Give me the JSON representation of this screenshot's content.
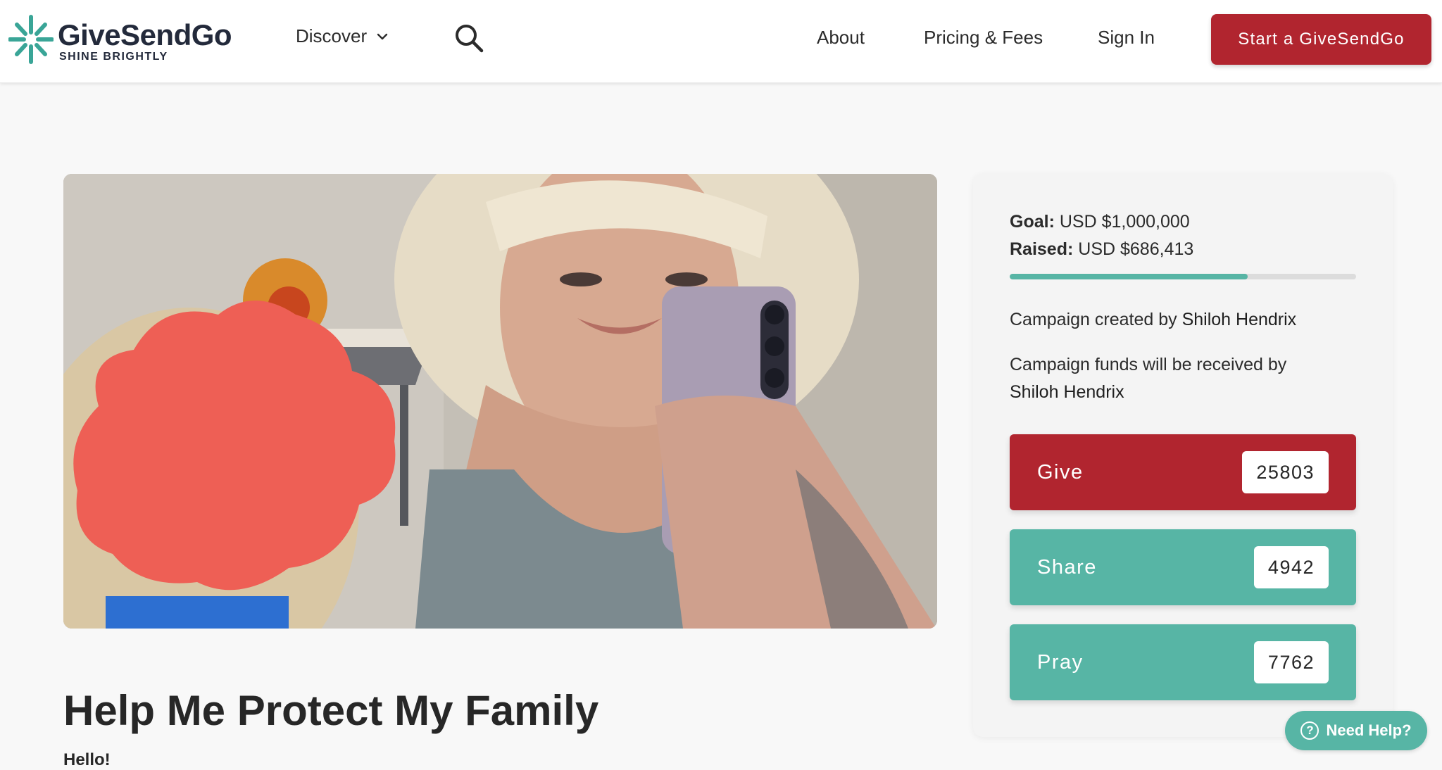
{
  "header": {
    "logo_name": "GiveSendGo",
    "logo_tagline": "SHINE BRIGHTLY",
    "discover_label": "Discover",
    "about_label": "About",
    "pricing_label": "Pricing & Fees",
    "signin_label": "Sign In",
    "cta_label": "Start a GiveSendGo"
  },
  "campaign": {
    "title": "Help Me Protect My Family",
    "greeting": "Hello!",
    "goal_label": "Goal:",
    "goal_value": "USD $1,000,000",
    "raised_label": "Raised:",
    "raised_value": "USD $686,413",
    "progress_fraction": 0.686,
    "created_by_text": "Campaign created by",
    "creator_name": "Shiloh Hendrix",
    "funds_text": "Campaign funds will be received by",
    "recipient_name": "Shiloh Hendrix"
  },
  "actions": {
    "give_label": "Give",
    "give_count": "25803",
    "share_label": "Share",
    "share_count": "4942",
    "pray_label": "Pray",
    "pray_count": "7762"
  },
  "help": {
    "label": "Need Help?",
    "icon_glyph": "?"
  },
  "colors": {
    "brand_teal": "#57b5a5",
    "brand_red": "#b1252f",
    "logo_navy": "#232a3b"
  }
}
